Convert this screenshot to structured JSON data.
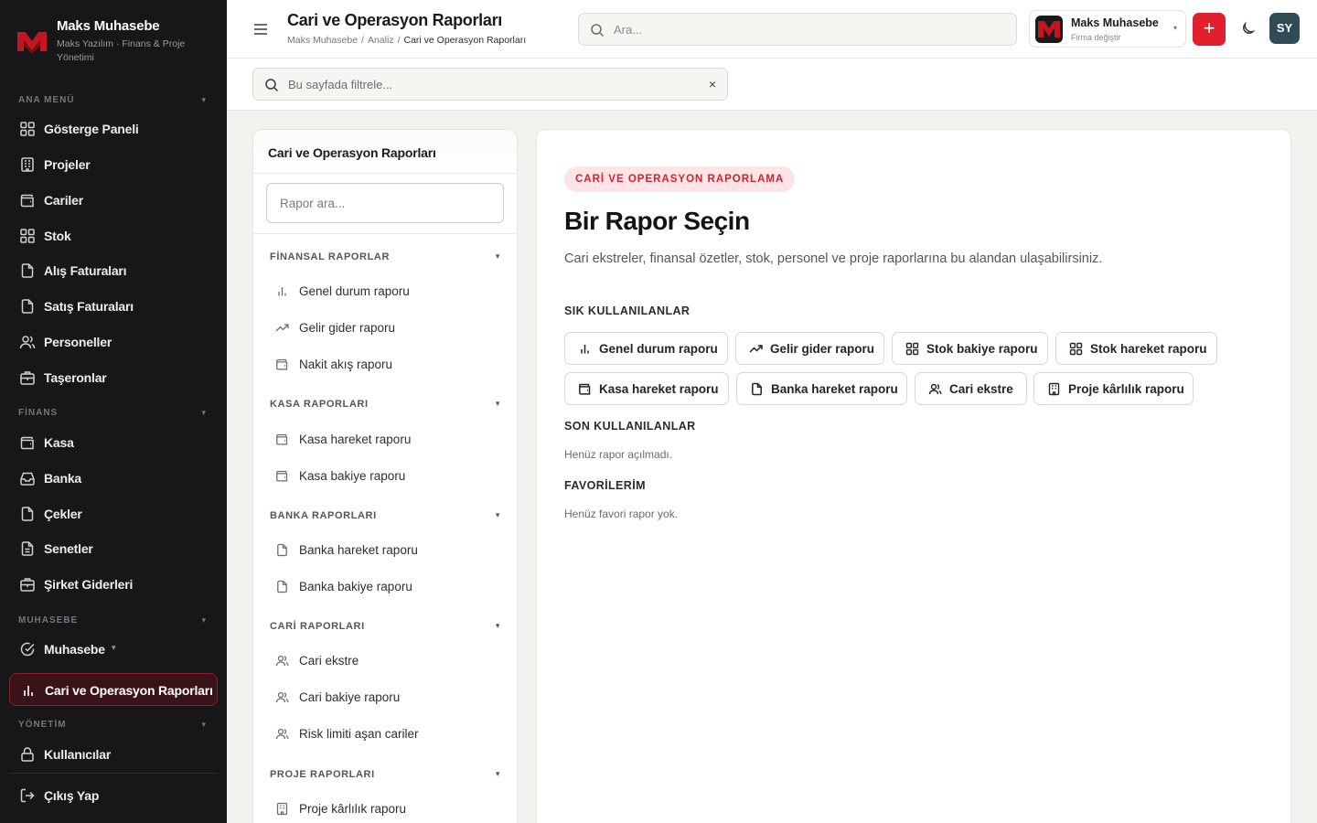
{
  "app": {
    "title": "Maks Muhasebe",
    "subtitle": "Maks Yazılım · Finans & Proje Yönetimi"
  },
  "colors": {
    "accent": "#e0202d",
    "sidebar_bg": "#17171a",
    "active_bg": "#3a1318",
    "avatar_bg": "#2f4b55",
    "pill_bg": "#fde4e6",
    "pill_text": "#cf2233"
  },
  "sidebar": {
    "sections": {
      "main": "ANA MENÜ",
      "finance": "FİNANS",
      "accounting": "MUHASEBE",
      "management": "YÖNETİM"
    },
    "items": [
      {
        "label": "Gösterge Paneli",
        "icon": "grid-icon"
      },
      {
        "label": "Projeler",
        "icon": "building-icon"
      },
      {
        "label": "Cariler",
        "icon": "wallet-icon"
      },
      {
        "label": "Stok",
        "icon": "grid-icon"
      },
      {
        "label": "Alış Faturaları",
        "icon": "file-icon"
      },
      {
        "label": "Satış Faturaları",
        "icon": "file-icon"
      },
      {
        "label": "Personeller",
        "icon": "users-icon"
      },
      {
        "label": "Taşeronlar",
        "icon": "briefcase-icon"
      },
      {
        "label": "Kasa",
        "icon": "wallet-icon"
      },
      {
        "label": "Banka",
        "icon": "inbox-icon"
      },
      {
        "label": "Çekler",
        "icon": "file-icon"
      },
      {
        "label": "Senetler",
        "icon": "file-text-icon"
      },
      {
        "label": "Şirket Giderleri",
        "icon": "briefcase-icon"
      },
      {
        "label": "Muhasebe",
        "icon": "check-circle-icon"
      },
      {
        "label": "Cari ve Operasyon Raporları",
        "icon": "bar-chart-icon",
        "active": true
      },
      {
        "label": "Kullanıcılar",
        "icon": "lock-icon"
      },
      {
        "label": "Çıkış Yap",
        "icon": "logout-icon"
      }
    ]
  },
  "header": {
    "page_title": "Cari ve Operasyon Raporları",
    "breadcrumb": [
      "Maks Muhasebe",
      "Analiz",
      "Cari ve Operasyon Raporları"
    ],
    "breadcrumb_sep": "/",
    "search_placeholder": "Ara...",
    "company": {
      "name": "Maks Muhasebe",
      "sub": "Firma değiştir"
    },
    "add_label": "+",
    "avatar_initials": "SY"
  },
  "filter": {
    "placeholder": "Bu sayfada filtrele...",
    "clear": "×"
  },
  "reports_panel": {
    "title": "Cari ve Operasyon Raporları",
    "search_placeholder": "Rapor ara...",
    "groups": [
      {
        "title": "FİNANSAL RAPORLAR",
        "items": [
          {
            "label": "Genel durum raporu",
            "icon": "bar-chart-icon"
          },
          {
            "label": "Gelir gider raporu",
            "icon": "trend-icon"
          },
          {
            "label": "Nakit akış raporu",
            "icon": "wallet-icon"
          }
        ]
      },
      {
        "title": "KASA RAPORLARI",
        "items": [
          {
            "label": "Kasa hareket raporu",
            "icon": "wallet-icon"
          },
          {
            "label": "Kasa bakiye raporu",
            "icon": "wallet-icon"
          }
        ]
      },
      {
        "title": "BANKA RAPORLARI",
        "items": [
          {
            "label": "Banka hareket raporu",
            "icon": "file-icon"
          },
          {
            "label": "Banka bakiye raporu",
            "icon": "file-icon"
          }
        ]
      },
      {
        "title": "CARİ RAPORLARI",
        "items": [
          {
            "label": "Cari ekstre",
            "icon": "users-icon"
          },
          {
            "label": "Cari bakiye raporu",
            "icon": "users-icon"
          },
          {
            "label": "Risk limiti aşan cariler",
            "icon": "users-icon"
          }
        ]
      },
      {
        "title": "PROJE RAPORLARI",
        "items": [
          {
            "label": "Proje kârlılık raporu",
            "icon": "building-icon"
          }
        ]
      }
    ]
  },
  "main": {
    "pill": "CARİ VE OPERASYON RAPORLAMA",
    "heading": "Bir Rapor Seçin",
    "description": "Cari ekstreler, finansal özetler, stok, personel ve proje raporlarına bu alandan ulaşabilirsiniz.",
    "frequent_title": "SIK KULLANILANLAR",
    "frequent": [
      {
        "label": "Genel durum raporu",
        "icon": "bar-chart-icon"
      },
      {
        "label": "Gelir gider raporu",
        "icon": "trend-icon"
      },
      {
        "label": "Stok bakiye raporu",
        "icon": "grid-icon"
      },
      {
        "label": "Stok hareket raporu",
        "icon": "grid-icon"
      },
      {
        "label": "Kasa hareket raporu",
        "icon": "wallet-icon"
      },
      {
        "label": "Banka hareket raporu",
        "icon": "file-icon"
      },
      {
        "label": "Cari ekstre",
        "icon": "users-icon"
      },
      {
        "label": "Proje kârlılık raporu",
        "icon": "building-icon"
      }
    ],
    "recent_title": "SON KULLANILANLAR",
    "recent_empty": "Henüz rapor açılmadı.",
    "favorites_title": "FAVORİLERİM",
    "favorites_empty": "Henüz favori rapor yok."
  }
}
